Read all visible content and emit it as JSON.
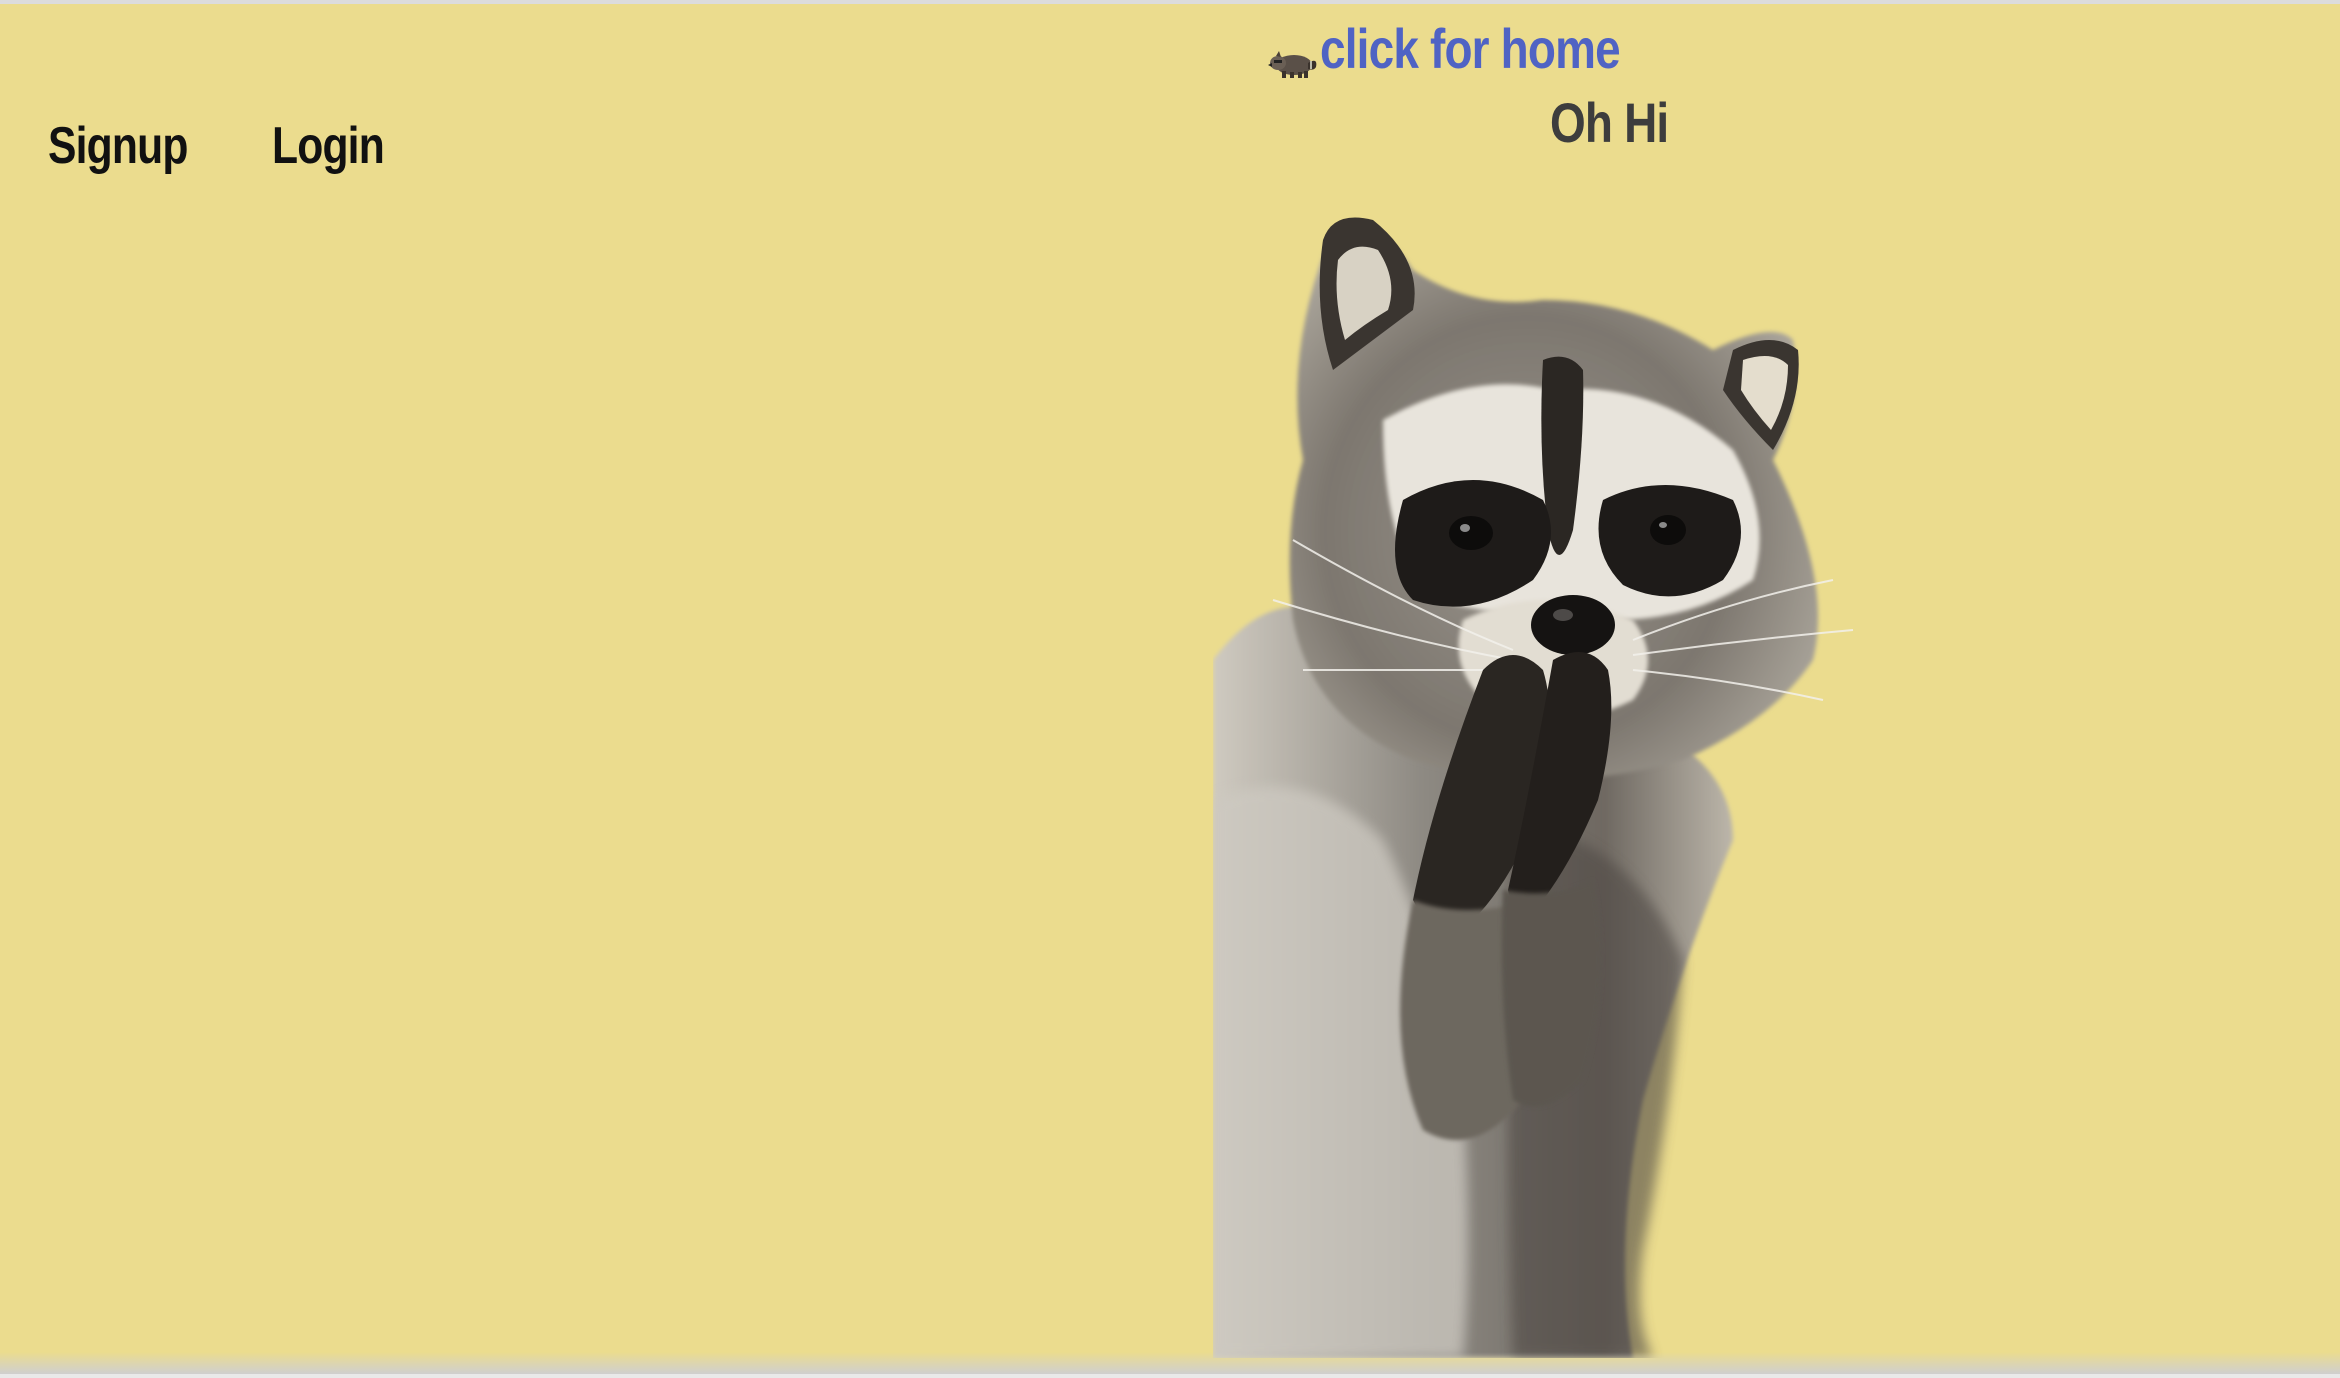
{
  "nav": {
    "signup_label": "Signup",
    "login_label": "Login"
  },
  "header": {
    "home_link_label": "click for home",
    "home_icon": "raccoon-icon",
    "greeting": "Oh Hi"
  },
  "hero": {
    "image_subject": "raccoon-photo"
  },
  "colors": {
    "background": "#ebdc8e",
    "home_link": "#4f63c4",
    "nav_text": "#111111",
    "greeting_text": "#3d3d3d"
  }
}
